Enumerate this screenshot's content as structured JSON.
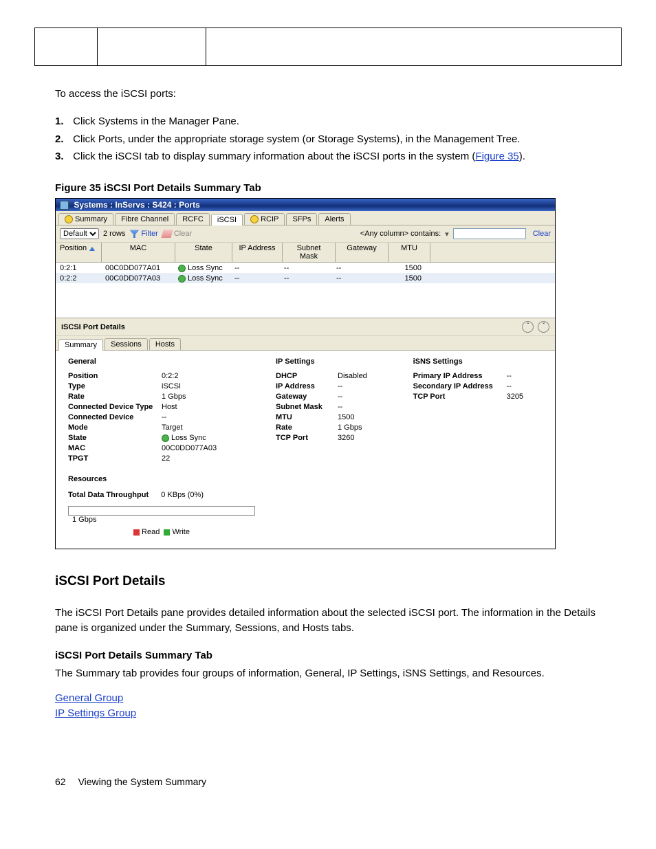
{
  "upper_cells": [
    "",
    "",
    ""
  ],
  "para_after_table": "To access the iSCSI ports:",
  "steps": [
    {
      "n": "1.",
      "text": "Click Systems in the Manager Pane."
    },
    {
      "n": "2.",
      "text": "Click Ports, under the appropriate storage system (or Storage Systems), in the Management Tree."
    },
    {
      "n": "3.",
      "text": "Click the iSCSI tab to display summary information about the iSCSI ports in the system (",
      "link_text": "Figure 35",
      "after": ")."
    }
  ],
  "figure_caption": "Figure 35 iSCSI Port Details Summary Tab",
  "titlebar": "Systems : InServs : S424 : Ports",
  "main_tabs": [
    {
      "label": "Summary",
      "dot": "yellow"
    },
    {
      "label": "Fibre Channel",
      "dot": null
    },
    {
      "label": "RCFC",
      "dot": null
    },
    {
      "label": "iSCSI",
      "dot": null,
      "active": true
    },
    {
      "label": "RCIP",
      "dot": "yellow"
    },
    {
      "label": "SFPs",
      "dot": null
    },
    {
      "label": "Alerts",
      "dot": null
    }
  ],
  "toolbar": {
    "view_value": "Default",
    "rows_text": "2 rows",
    "filter_label": "Filter",
    "clear_label": "Clear",
    "contains_label": "<Any column> contains:",
    "clear_link": "Clear"
  },
  "columns": [
    "Position",
    "MAC",
    "State",
    "IP Address",
    "Subnet Mask",
    "Gateway",
    "MTU"
  ],
  "rows": [
    {
      "pos": "0:2:1",
      "mac": "00C0DD077A01",
      "state": "Loss Sync",
      "ip": "--",
      "mask": "--",
      "gw": "--",
      "mtu": "1500"
    },
    {
      "pos": "0:2:2",
      "mac": "00C0DD077A03",
      "state": "Loss Sync",
      "ip": "--",
      "mask": "--",
      "gw": "--",
      "mtu": "1500"
    }
  ],
  "details_hdr": "iSCSI Port Details",
  "detail_tabs": [
    "Summary",
    "Sessions",
    "Hosts"
  ],
  "general": {
    "hdr": "General",
    "items": [
      {
        "k": "Position",
        "v": "0:2:2"
      },
      {
        "k": "Type",
        "v": "iSCSI"
      },
      {
        "k": "Rate",
        "v": "1 Gbps"
      },
      {
        "k": "Connected Device Type",
        "v": "Host"
      },
      {
        "k": "Connected Device",
        "v": "--"
      },
      {
        "k": "Mode",
        "v": "Target"
      },
      {
        "k": "State",
        "v": "Loss Sync",
        "dot": true
      },
      {
        "k": "MAC",
        "v": "00C0DD077A03"
      },
      {
        "k": "TPGT",
        "v": "22"
      }
    ]
  },
  "ipsettings": {
    "hdr": "IP Settings",
    "items": [
      {
        "k": "DHCP",
        "v": "Disabled"
      },
      {
        "k": "IP Address",
        "v": "--"
      },
      {
        "k": "Gateway",
        "v": "--"
      },
      {
        "k": "Subnet Mask",
        "v": "--"
      },
      {
        "k": "MTU",
        "v": "1500"
      },
      {
        "k": "Rate",
        "v": "1 Gbps"
      },
      {
        "k": "TCP Port",
        "v": "3260"
      }
    ]
  },
  "isns": {
    "hdr": "iSNS Settings",
    "items": [
      {
        "k": "Primary IP Address",
        "v": "--"
      },
      {
        "k": "Secondary IP Address",
        "v": "--"
      },
      {
        "k": "TCP Port",
        "v": "3205"
      }
    ]
  },
  "resources": {
    "hdr": "Resources",
    "throughput_k": "Total Data Throughput",
    "throughput_v": "0 KBps (0%)",
    "bar_label": "1 Gbps",
    "legend_read": "Read",
    "legend_write": "Write"
  },
  "post": {
    "intro": "The iSCSI Port Details pane provides detailed information about the selected iSCSI port. The information in the Details pane is organized under the Summary, Sessions, and Hosts tabs.",
    "sub_hdr": "iSCSI Port Details Summary Tab",
    "sub_text": "The Summary tab provides four groups of information, General, IP Settings, iSNS Settings, and Resources.",
    "links": [
      "General Group",
      "IP Settings Group"
    ]
  },
  "section_hdr": "iSCSI Port Details",
  "footer": {
    "page": "62",
    "title": "Viewing the System Summary"
  }
}
